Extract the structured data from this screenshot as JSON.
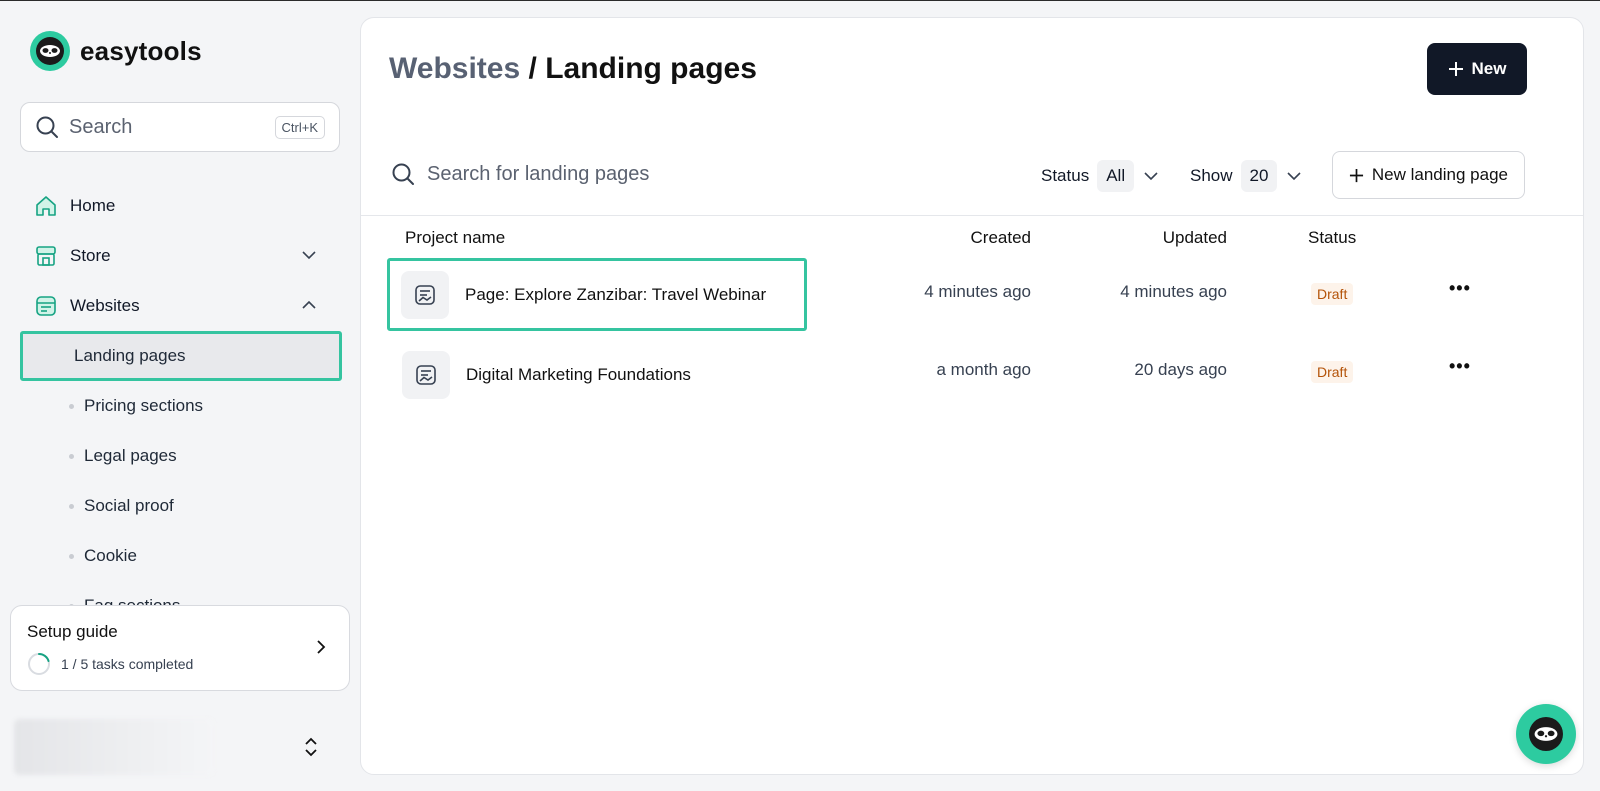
{
  "brand": {
    "name": "easytools"
  },
  "search": {
    "placeholder": "Search",
    "shortcut": "Ctrl+K"
  },
  "nav": {
    "items": [
      {
        "label": "Home"
      },
      {
        "label": "Store"
      },
      {
        "label": "Websites"
      }
    ],
    "subitems": [
      {
        "label": "Landing pages"
      },
      {
        "label": "Pricing sections"
      },
      {
        "label": "Legal pages"
      },
      {
        "label": "Social proof"
      },
      {
        "label": "Cookie"
      },
      {
        "label": "Faq sections"
      }
    ]
  },
  "setup": {
    "title": "Setup guide",
    "progress": "1 / 5 tasks completed",
    "completed": 1,
    "total": 5
  },
  "header": {
    "crumb": "Websites",
    "separator": "/",
    "title": "Landing pages",
    "new_label": "New"
  },
  "toolbar": {
    "search_placeholder": "Search for landing pages",
    "status_label": "Status",
    "status_value": "All",
    "show_label": "Show",
    "show_value": "20",
    "new_landing_label": "New landing page"
  },
  "table": {
    "columns": [
      "Project name",
      "Created",
      "Updated",
      "Status"
    ],
    "rows": [
      {
        "name": "Page: Explore Zanzibar: Travel Webinar",
        "created": "4 minutes ago",
        "updated": "4 minutes ago",
        "status": "Draft"
      },
      {
        "name": "Digital Marketing Foundations",
        "created": "a month ago",
        "updated": "20 days ago",
        "status": "Draft"
      }
    ]
  },
  "colors": {
    "accent": "#2dcba0",
    "primary": "#111827",
    "draft": "#b45309"
  }
}
